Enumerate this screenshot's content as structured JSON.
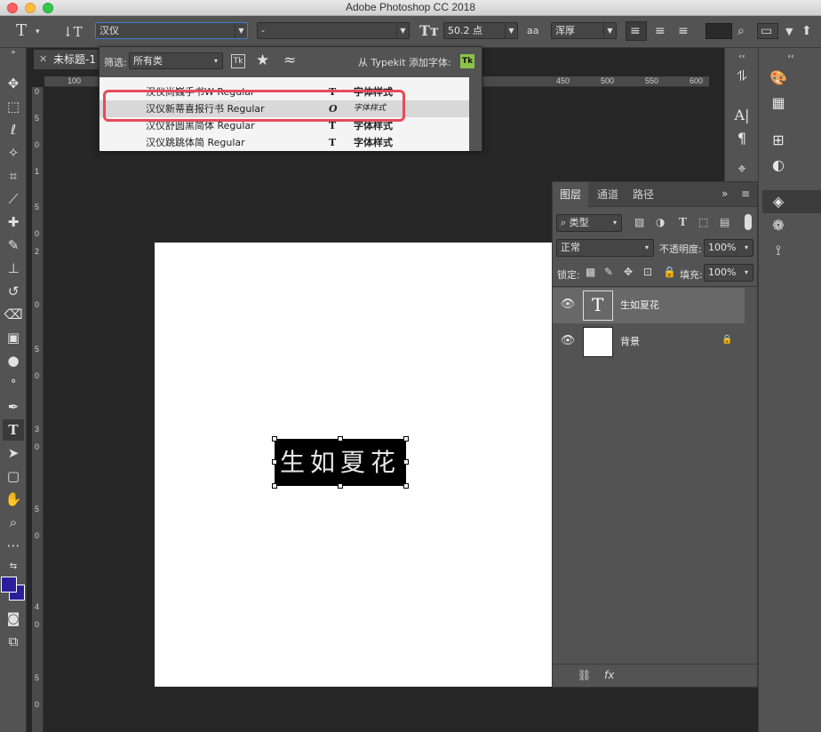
{
  "app": {
    "title": "Adobe Photoshop CC 2018"
  },
  "options_bar": {
    "font_family": "汉仪",
    "font_style": "-",
    "font_size": "50.2 点",
    "anti_alias": "浑厚",
    "anti_alias_icon": "aa"
  },
  "document": {
    "tab_title": "未标题-1",
    "text_content": "生如夏花"
  },
  "rulers": {
    "top": [
      "100",
      "450",
      "500",
      "550",
      "600"
    ],
    "left": [
      "0",
      "5",
      "0",
      "1",
      "5",
      "0",
      "2",
      "0",
      "5",
      "0",
      "3",
      "0",
      "5",
      "0",
      "4",
      "0",
      "5",
      "0"
    ]
  },
  "font_dropdown": {
    "filter_label": "筛选:",
    "filter_value": "所有类",
    "tk_badge": "Tk",
    "typekit_label": "从 Typekit 添加字体:",
    "typekit_badge": "Tk",
    "fonts": [
      {
        "name": "汉仪尚巍手书W Regular",
        "icon": "T",
        "sample": "字体样式"
      },
      {
        "name": "汉仪新蒂喜报行书 Regular",
        "icon": "O",
        "sample": "字体样式",
        "selected": true
      },
      {
        "name": "汉仪舒圆黑简体 Regular",
        "icon": "T",
        "sample": "字体样式"
      },
      {
        "name": "汉仪跳跳体简 Regular",
        "icon": "T",
        "sample": "字体样式"
      }
    ]
  },
  "layers_panel": {
    "tabs": [
      "图层",
      "通道",
      "路径"
    ],
    "filter_kind": "类型",
    "blend_mode": "正常",
    "opacity_label": "不透明度:",
    "opacity_value": "100%",
    "lock_label": "锁定:",
    "fill_label": "填充:",
    "fill_value": "100%",
    "layers": [
      {
        "name": "生如夏花",
        "type": "text",
        "selected": true,
        "thumb": "T"
      },
      {
        "name": "背景",
        "type": "background",
        "selected": false
      }
    ],
    "footer_icons": [
      "link-icon",
      "fx-icon"
    ],
    "footer_fx": "fx"
  },
  "colors": {
    "foreground": "#2a1e9a",
    "background": "#2a1e9a",
    "highlight": "#e84a5a",
    "panel": "#535353"
  }
}
